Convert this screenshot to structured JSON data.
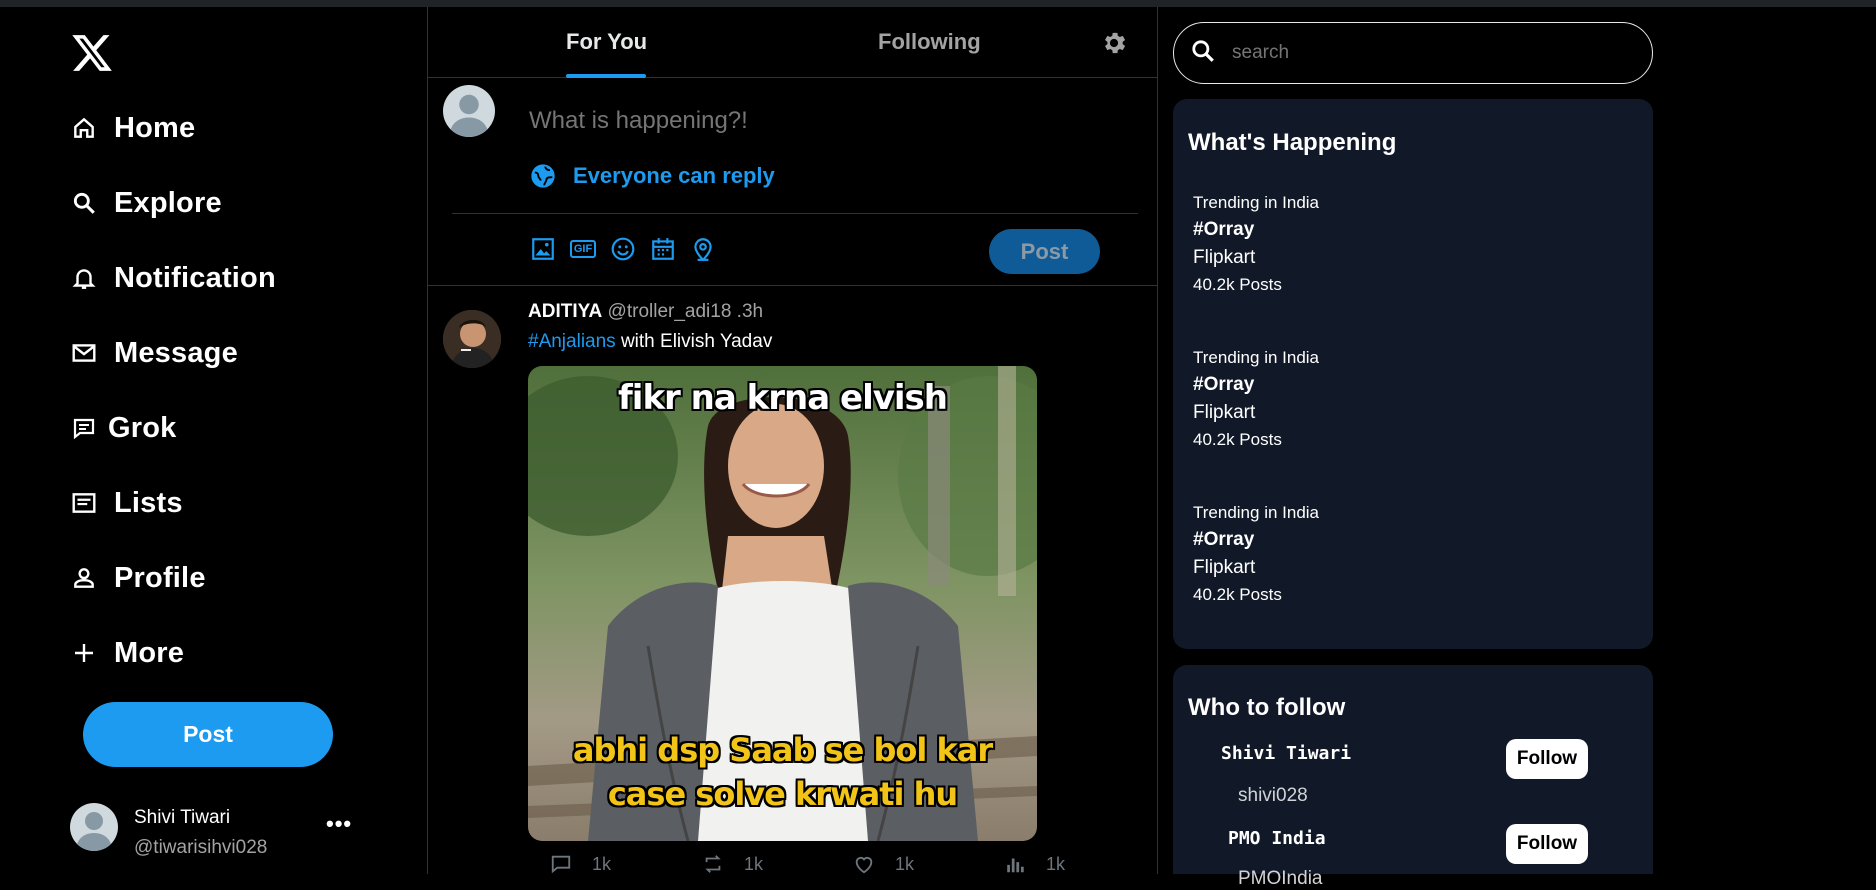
{
  "nav": {
    "logo": "x-logo",
    "items": [
      {
        "label": "Home",
        "icon": "home-icon"
      },
      {
        "label": "Explore",
        "icon": "search-icon"
      },
      {
        "label": "Notification",
        "icon": "bell-icon"
      },
      {
        "label": "Message",
        "icon": "mail-icon"
      },
      {
        "label": "Grok",
        "icon": "chat-icon"
      },
      {
        "label": "Lists",
        "icon": "list-icon"
      },
      {
        "label": "Profile",
        "icon": "person-icon"
      },
      {
        "label": "More",
        "icon": "plus-icon"
      }
    ],
    "post_label": "Post"
  },
  "me": {
    "name": "Shivi Tiwari",
    "handle": "@tiwarisihvi028",
    "more": "•••"
  },
  "tabs": {
    "for_you": "For You",
    "following": "Following"
  },
  "compose": {
    "placeholder": "What is happening?!",
    "reply_setting": "Everyone can reply",
    "gif_label": "GIF",
    "post_label": "Post"
  },
  "tweet": {
    "name": "ADITIYA",
    "meta": "@troller_adi18 .3h",
    "hashtag": "#Anjalians",
    "text": " with Elivish Yadav",
    "meme_top": "fikr na krna elvish",
    "meme_bottom_1": "abhi dsp Saab se bol kar",
    "meme_bottom_2": "case solve krwati hu",
    "replies": "1k",
    "reposts": "1k",
    "likes": "1k",
    "views": "1k"
  },
  "search": {
    "placeholder": "search"
  },
  "whats_happening": {
    "title": "What's Happening",
    "trends": [
      {
        "context": "Trending in India",
        "hashtag": "#Orray",
        "topic": "Flipkart",
        "count": "40.2k Posts"
      },
      {
        "context": "Trending in India",
        "hashtag": "#Orray",
        "topic": "Flipkart",
        "count": "40.2k Posts"
      },
      {
        "context": "Trending in India",
        "hashtag": "#Orray",
        "topic": "Flipkart",
        "count": "40.2k Posts"
      }
    ]
  },
  "who_to_follow": {
    "title": "Who to follow",
    "users": [
      {
        "name": "Shivi Tiwari",
        "handle": "shivi028",
        "button": "Follow"
      },
      {
        "name": "PMO India",
        "handle": "PMOIndia",
        "button": "Follow"
      }
    ]
  },
  "colors": {
    "accent": "#1d9bf0",
    "background": "#000000",
    "panel": "#111827",
    "muted": "#a3a3a3"
  }
}
